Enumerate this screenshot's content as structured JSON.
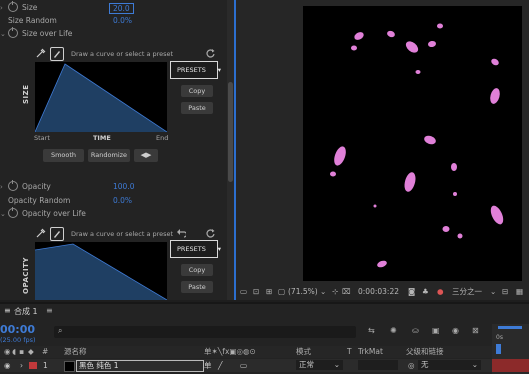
{
  "effect_controls": {
    "size": {
      "label": "Size",
      "value": "20.0"
    },
    "size_random": {
      "label": "Size Random",
      "value": "0.0%"
    },
    "size_over_life": {
      "label": "Size over Life"
    },
    "graph1": {
      "hint": "Draw a curve or select a preset",
      "axis_label": "SIZE",
      "presets_label": "PRESETS",
      "copy_label": "Copy",
      "paste_label": "Paste",
      "x_start": "Start",
      "x_mid": "TIME",
      "x_end": "End",
      "smooth_label": "Smooth",
      "randomize_label": "Randomize"
    },
    "opacity": {
      "label": "Opacity",
      "value": "100.0"
    },
    "opacity_random": {
      "label": "Opacity Random",
      "value": "0.0%"
    },
    "opacity_over_life": {
      "label": "Opacity over Life"
    },
    "graph2": {
      "hint": "Draw a curve or select a preset",
      "axis_label": "OPACITY",
      "presets_label": "PRESETS",
      "copy_label": "Copy",
      "paste_label": "Paste"
    }
  },
  "viewer": {
    "zoom": "(71.5%)",
    "timecode": "0:00:03:22",
    "resolution": "三分之一"
  },
  "timeline": {
    "comp_tab": "合成 1",
    "timecode": "00:00",
    "fps": "(25.00 fps)",
    "search_placeholder": "",
    "columns": {
      "num": "#",
      "source_name": "源名称",
      "mode": "模式",
      "t": "T",
      "trkmat": "TrkMat",
      "parent": "父级和链接"
    },
    "layer": {
      "index": "1",
      "name": "黑色 纯色 1",
      "mode": "正常",
      "parent": "无",
      "label_color": "#c0393b"
    }
  },
  "colors": {
    "accent": "#3e7bd6",
    "graph_fill": "#1f3f63",
    "petal": "#e080d8"
  }
}
